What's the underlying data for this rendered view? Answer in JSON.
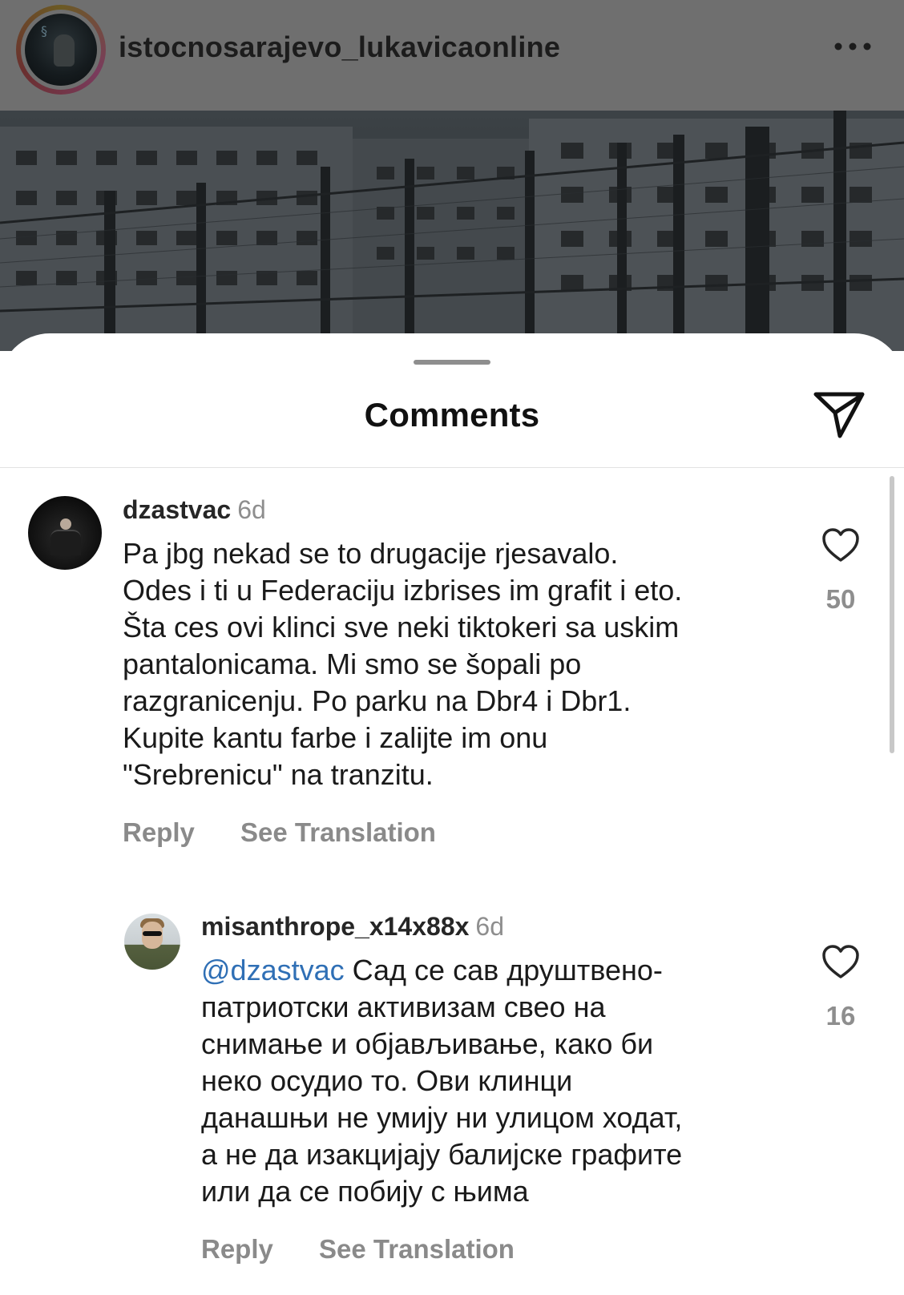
{
  "header": {
    "username": "istocnosarajevo_lukavicaonline",
    "more_icon": "more-horizontal-icon"
  },
  "sheet": {
    "title": "Comments",
    "share_icon": "send-icon"
  },
  "comments": [
    {
      "username": "dzastvac",
      "time": "6d",
      "lines": [
        "Pa jbg nekad se to drugacije rjesavalo.",
        "Odes i ti u Federaciju izbrises im grafit i eto.",
        "Šta ces ovi klinci sve neki tiktokeri sa uskim",
        "pantalonicama. Mi smo se šopali po",
        "razgranicenju. Po parku na Dbr4 i Dbr1.",
        "Kupite kantu farbe i zalijte im onu",
        "\"Srebrenicu\" na tranzitu."
      ],
      "likes": "50",
      "reply_label": "Reply",
      "translate_label": "See Translation"
    },
    {
      "username": "misanthrope_x14x88x",
      "time": "6d",
      "mention": "@dzastvac",
      "first_line_rest": " Сад се сав друштвено-",
      "lines": [
        "патриотски активизам свео на",
        "снимање и објављивање, како би",
        "неко осудио то. Ови клинци",
        "данашњи не умију ни улицом ходат,",
        "а не да изакцијају балијске графите",
        "или да се побију с њима"
      ],
      "likes": "16",
      "reply_label": "Reply",
      "translate_label": "See Translation"
    }
  ],
  "colors": {
    "mention": "#2f6fb5",
    "secondary_text": "#8e8e8e",
    "header_dim": "#6f6f6f"
  }
}
